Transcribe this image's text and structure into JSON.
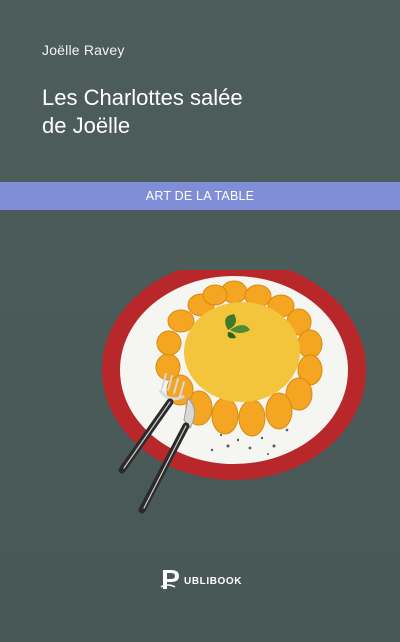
{
  "book": {
    "author": "Joëlle Ravey",
    "title_line1": "Les Charlottes salée",
    "title_line2": "de Joëlle",
    "category": "ART DE LA TABLE",
    "publisher": "UBLIBOOK"
  },
  "colors": {
    "background": "#4a5a58",
    "band": "#7f8ed6",
    "plate_rim": "#b8282a",
    "plate_center": "#f5f5f2",
    "charlotte": "#f3c53d",
    "biscuit": "#f4a623"
  },
  "icons": {
    "illustration": "plate-with-charlotte-illustration",
    "publisher_logo": "publibook-logo-icon"
  }
}
